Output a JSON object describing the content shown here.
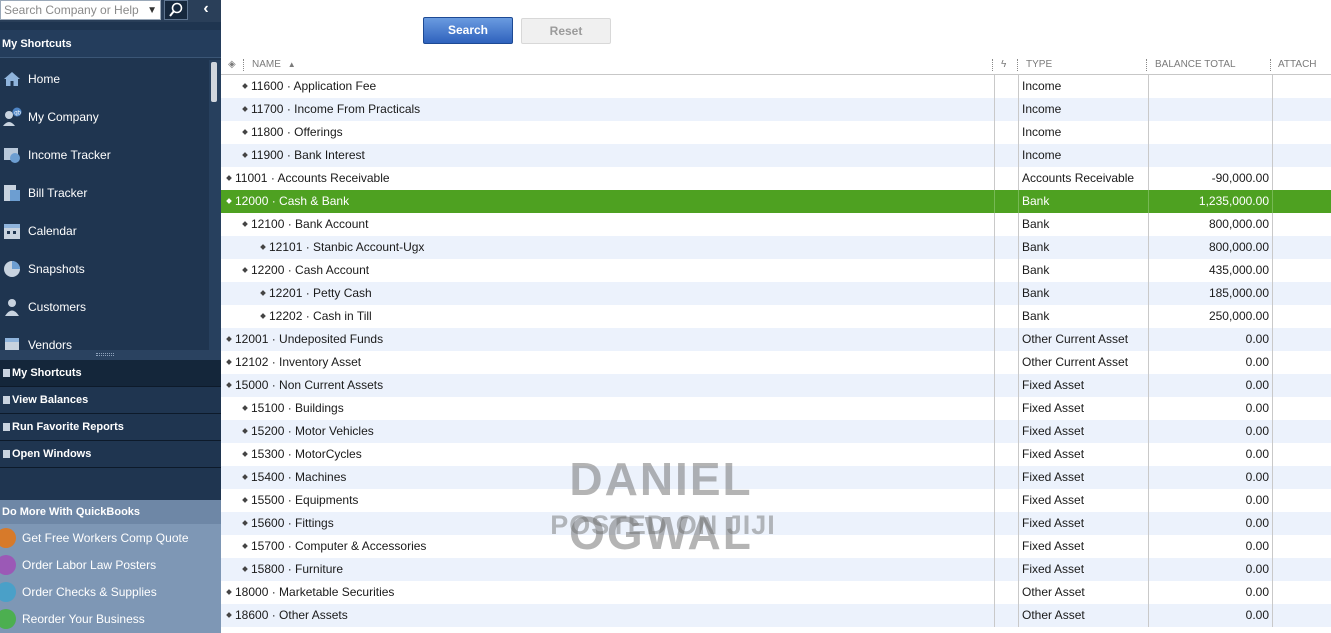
{
  "sidebar": {
    "search_placeholder": "Search Company or Help",
    "shortcuts_title": "My Shortcuts",
    "shortcuts": [
      {
        "label": "Home",
        "icon": "home-icon"
      },
      {
        "label": "My Company",
        "icon": "company-icon"
      },
      {
        "label": "Income Tracker",
        "icon": "income-tracker-icon"
      },
      {
        "label": "Bill Tracker",
        "icon": "bill-tracker-icon"
      },
      {
        "label": "Calendar",
        "icon": "calendar-icon"
      },
      {
        "label": "Snapshots",
        "icon": "pie-chart-icon"
      },
      {
        "label": "Customers",
        "icon": "person-icon"
      },
      {
        "label": "Vendors",
        "icon": "vendors-icon"
      }
    ],
    "nav_buttons": [
      {
        "label": "My Shortcuts"
      },
      {
        "label": "View Balances"
      },
      {
        "label": "Run Favorite Reports"
      },
      {
        "label": "Open Windows"
      }
    ],
    "do_more_title": "Do More With QuickBooks",
    "do_more_items": [
      {
        "label": "Get Free Workers Comp Quote",
        "color": "#d77a2a"
      },
      {
        "label": "Order Labor Law Posters",
        "color": "#9b59b6"
      },
      {
        "label": "Order Checks & Supplies",
        "color": "#4aa0c8"
      },
      {
        "label": "Reorder Your Business",
        "color": "#4caf50"
      }
    ]
  },
  "toolbar": {
    "search_label": "Search",
    "reset_label": "Reset"
  },
  "grid": {
    "columns": {
      "name": "NAME",
      "type": "TYPE",
      "balance": "BALANCE TOTAL",
      "attach": "ATTACH"
    },
    "rows": [
      {
        "name": "11600 · Application Fee",
        "level": 1,
        "type": "Income",
        "balance": ""
      },
      {
        "name": "11700 · Income From Practicals",
        "level": 1,
        "type": "Income",
        "balance": ""
      },
      {
        "name": "11800 · Offerings",
        "level": 1,
        "type": "Income",
        "balance": ""
      },
      {
        "name": "11900 · Bank Interest",
        "level": 1,
        "type": "Income",
        "balance": ""
      },
      {
        "name": "11001 · Accounts Receivable",
        "level": 0,
        "type": "Accounts Receivable",
        "balance": "-90,000.00"
      },
      {
        "name": "12000 · Cash & Bank",
        "level": 0,
        "type": "Bank",
        "balance": "1,235,000.00",
        "selected": true
      },
      {
        "name": "12100 · Bank Account",
        "level": 1,
        "type": "Bank",
        "balance": "800,000.00"
      },
      {
        "name": "12101 · Stanbic Account-Ugx",
        "level": 2,
        "type": "Bank",
        "balance": "800,000.00"
      },
      {
        "name": "12200 · Cash Account",
        "level": 1,
        "type": "Bank",
        "balance": "435,000.00"
      },
      {
        "name": "12201 · Petty Cash",
        "level": 2,
        "type": "Bank",
        "balance": "185,000.00"
      },
      {
        "name": "12202 · Cash in Till",
        "level": 2,
        "type": "Bank",
        "balance": "250,000.00"
      },
      {
        "name": "12001 · Undeposited Funds",
        "level": 0,
        "type": "Other Current Asset",
        "balance": "0.00"
      },
      {
        "name": "12102 · Inventory Asset",
        "level": 0,
        "type": "Other Current Asset",
        "balance": "0.00"
      },
      {
        "name": "15000 · Non Current Assets",
        "level": 0,
        "type": "Fixed Asset",
        "balance": "0.00"
      },
      {
        "name": "15100 · Buildings",
        "level": 1,
        "type": "Fixed Asset",
        "balance": "0.00"
      },
      {
        "name": "15200 · Motor Vehicles",
        "level": 1,
        "type": "Fixed Asset",
        "balance": "0.00"
      },
      {
        "name": "15300 · MotorCycles",
        "level": 1,
        "type": "Fixed Asset",
        "balance": "0.00"
      },
      {
        "name": "15400 · Machines",
        "level": 1,
        "type": "Fixed Asset",
        "balance": "0.00"
      },
      {
        "name": "15500 · Equipments",
        "level": 1,
        "type": "Fixed Asset",
        "balance": "0.00"
      },
      {
        "name": "15600 · Fittings",
        "level": 1,
        "type": "Fixed Asset",
        "balance": "0.00"
      },
      {
        "name": "15700 · Computer & Accessories",
        "level": 1,
        "type": "Fixed Asset",
        "balance": "0.00"
      },
      {
        "name": "15800 · Furniture",
        "level": 1,
        "type": "Fixed Asset",
        "balance": "0.00"
      },
      {
        "name": "18000 · Marketable Securities",
        "level": 0,
        "type": "Other Asset",
        "balance": "0.00"
      },
      {
        "name": "18600 · Other Assets",
        "level": 0,
        "type": "Other Asset",
        "balance": "0.00"
      }
    ]
  },
  "watermark": {
    "line1": "DANIEL OGWAL",
    "line2": "POSTED ON JIJI"
  },
  "colors": {
    "sidebar_bg": "#1f3550",
    "selected_row": "#4ea121",
    "alt_row": "#ecf2fc",
    "search_button": "#2f62bd"
  }
}
